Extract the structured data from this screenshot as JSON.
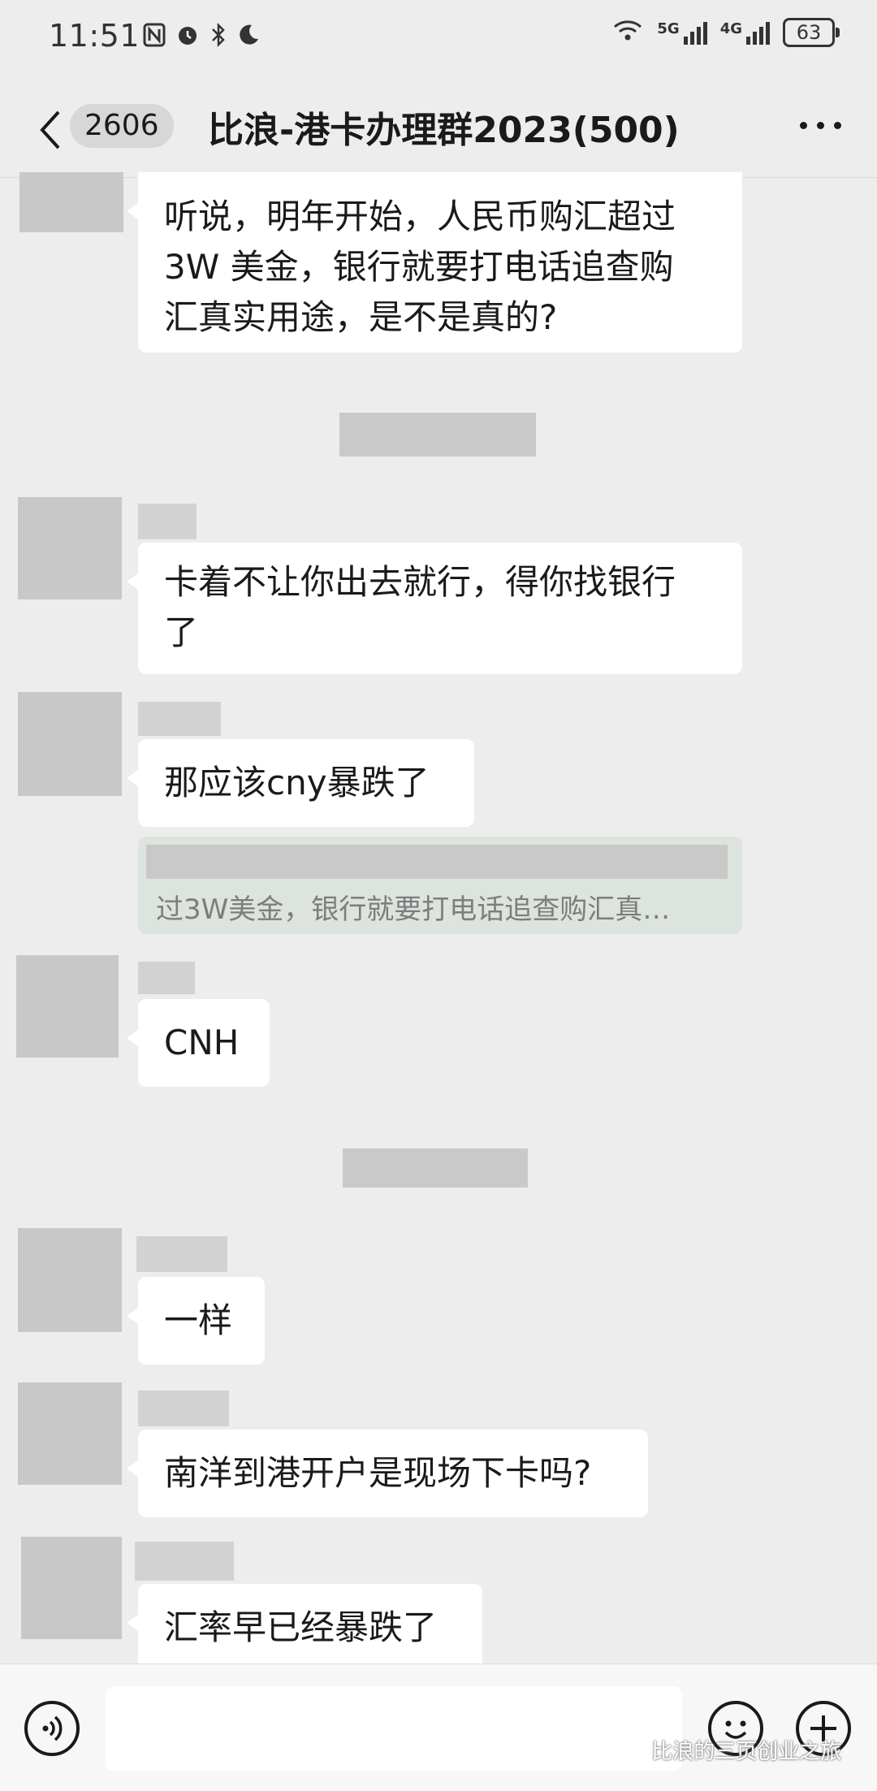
{
  "status_bar": {
    "time": "11:51",
    "signal_5g_label": "5G",
    "signal_4g_label": "4G",
    "battery": "63"
  },
  "header": {
    "unread_count": "2606",
    "title": "比浪-港卡办理群2023(500)"
  },
  "messages": [
    {
      "lines": [
        "听说，明年开始，人民币购汇超过",
        "3W 美金，银行就要打电话追查购",
        "汇真实用途，是不是真的?"
      ]
    },
    {
      "lines": [
        "卡着不让你出去就行，得你找银行",
        "了"
      ]
    },
    {
      "lines": [
        "那应该cny暴跌了"
      ]
    },
    {
      "lines": [
        "CNH"
      ]
    },
    {
      "lines": [
        "一样"
      ]
    },
    {
      "lines": [
        "南洋到港开户是现场下卡吗?"
      ]
    },
    {
      "lines": [
        "汇率早已经暴跌了"
      ]
    }
  ],
  "quote": {
    "text": "过3W美金，银行就要打电话追查购汇真…"
  },
  "watermark": "比浪的三页创业之旅",
  "colors": {
    "background": "#ededed",
    "bubble": "#ffffff",
    "redacted": "#c8c8c8"
  },
  "icons": [
    "nfc-icon",
    "alarm-icon",
    "bluetooth-icon",
    "moon-icon",
    "wifi-icon",
    "signal-icon",
    "battery-icon",
    "back-chevron-icon",
    "more-icon",
    "voice-icon",
    "emoji-icon",
    "plus-icon",
    "wechat-icon"
  ]
}
